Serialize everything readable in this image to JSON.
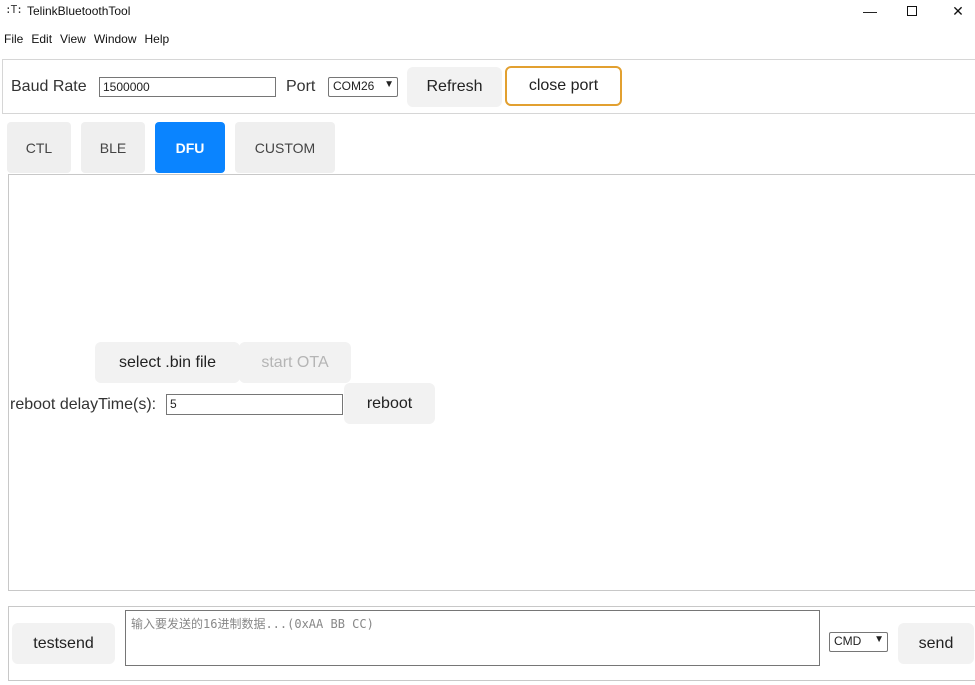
{
  "window": {
    "icon_text": "T",
    "title": "TelinkBluetoothTool",
    "minimize_symbol": "—",
    "close_symbol": "✕"
  },
  "menu": [
    "File",
    "Edit",
    "View",
    "Window",
    "Help"
  ],
  "connection": {
    "baud_label": "Baud Rate",
    "baud_value": "1500000",
    "port_label": "Port",
    "port_value": "COM26",
    "refresh_label": "Refresh",
    "close_port_label": "close port",
    "accent_color": "#e2a030"
  },
  "tabs": [
    {
      "label": "CTL",
      "active": false
    },
    {
      "label": "BLE",
      "active": false
    },
    {
      "label": "DFU",
      "active": true
    },
    {
      "label": "CUSTOM",
      "active": false
    }
  ],
  "active_tab_color": "#0a84ff",
  "dfu": {
    "select_bin_label": "select .bin file",
    "start_ota_label": "start OTA",
    "start_ota_disabled": true,
    "reboot_label": "reboot delayTime(s):",
    "reboot_value": "5",
    "reboot_button_label": "reboot"
  },
  "send": {
    "testsend_label": "testsend",
    "input_placeholder": "输入要发送的16进制数据...(0xAA BB CC)",
    "mode_value": "CMD",
    "send_label": "send"
  }
}
